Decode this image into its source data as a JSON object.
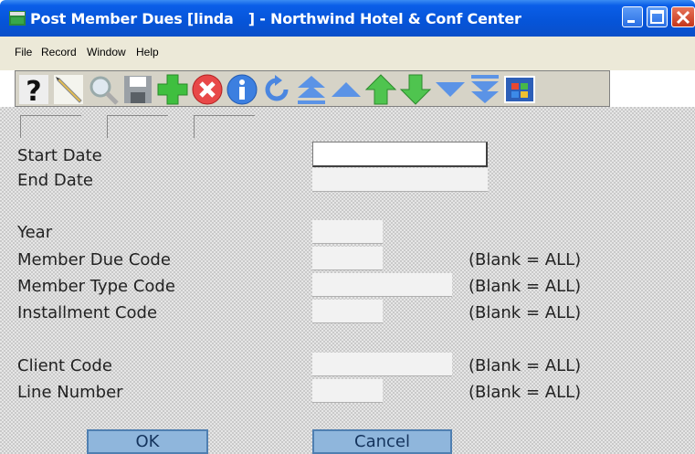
{
  "window": {
    "title": "Post Member Dues [linda   ] - Northwind Hotel & Conf Center",
    "controls": [
      "minimize-icon",
      "maximize-icon",
      "close-icon"
    ]
  },
  "menu": {
    "items": [
      "File",
      "Record",
      "Window",
      "Help"
    ]
  },
  "toolbar": {
    "icons": [
      "help-icon",
      "edit-pencil-icon",
      "search-magnifier-icon",
      "save-disk-icon",
      "add-plus-icon",
      "delete-x-icon",
      "info-icon",
      "refresh-icon",
      "first-record-icon",
      "previous-record-icon",
      "page-up-icon",
      "page-down-icon",
      "next-record-icon",
      "last-record-icon",
      "windows-flag-icon"
    ]
  },
  "form": {
    "start_date": {
      "label": "Start Date",
      "value": ""
    },
    "end_date": {
      "label": "End Date",
      "value": ""
    },
    "year": {
      "label": "Year",
      "value": ""
    },
    "member_due_code": {
      "label": "Member Due Code",
      "value": "",
      "note": "(Blank = ALL)"
    },
    "member_type_code": {
      "label": "Member Type Code",
      "value": "",
      "note": "(Blank = ALL)"
    },
    "installment_code": {
      "label": "Installment Code",
      "value": "",
      "note": "(Blank = ALL)"
    },
    "client_code": {
      "label": "Client Code",
      "value": "",
      "note": "(Blank = ALL)"
    },
    "line_number": {
      "label": "Line Number",
      "value": "",
      "note": "(Blank = ALL)"
    }
  },
  "buttons": {
    "ok": "OK",
    "cancel": "Cancel"
  },
  "colors": {
    "titlebar": "#0654d8",
    "button_fill": "#8fb6dc",
    "button_border": "#4f7fb1",
    "menubar": "#ece9d8"
  }
}
